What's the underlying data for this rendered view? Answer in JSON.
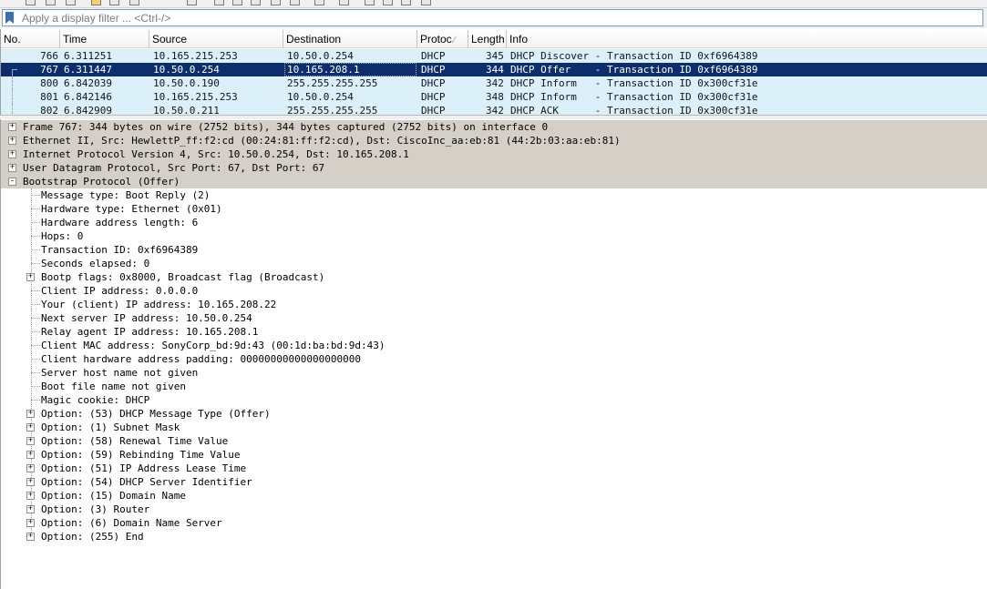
{
  "filter": {
    "placeholder": "Apply a display filter ... <Ctrl-/>"
  },
  "packet_list": {
    "columns": [
      {
        "label": "No."
      },
      {
        "label": "Time"
      },
      {
        "label": "Source"
      },
      {
        "label": "Destination"
      },
      {
        "label": "Protoc",
        "sort_icon": "sort-arrow-icon"
      },
      {
        "label": "Length"
      },
      {
        "label": "Info"
      }
    ],
    "rows": [
      {
        "no": "766",
        "time": "6.311251",
        "source": "10.165.215.253",
        "destination": "10.50.0.254",
        "protocol": "DHCP",
        "length": "345",
        "info": "DHCP Discover - Transaction ID 0xf6964389",
        "selected": false
      },
      {
        "no": "767",
        "time": "6.311447",
        "source": "10.50.0.254",
        "destination": "10.165.208.1",
        "protocol": "DHCP",
        "length": "344",
        "info": "DHCP Offer    - Transaction ID 0xf6964389",
        "selected": true
      },
      {
        "no": "800",
        "time": "6.842039",
        "source": "10.50.0.190",
        "destination": "255.255.255.255",
        "protocol": "DHCP",
        "length": "342",
        "info": "DHCP Inform   - Transaction ID 0x300cf31e",
        "selected": false
      },
      {
        "no": "801",
        "time": "6.842146",
        "source": "10.165.215.253",
        "destination": "10.50.0.254",
        "protocol": "DHCP",
        "length": "348",
        "info": "DHCP Inform   - Transaction ID 0x300cf31e",
        "selected": false
      },
      {
        "no": "802",
        "time": "6.842909",
        "source": "10.50.0.211",
        "destination": "255.255.255.255",
        "protocol": "DHCP",
        "length": "342",
        "info": "DHCP ACK      - Transaction ID 0x300cf31e",
        "selected": false
      }
    ]
  },
  "details": {
    "top_level": [
      {
        "text": "Frame 767: 344 bytes on wire (2752 bits), 344 bytes captured (2752 bits) on interface 0",
        "expander": "+"
      },
      {
        "text": "Ethernet II, Src: HewlettP_ff:f2:cd (00:24:81:ff:f2:cd), Dst: CiscoInc_aa:eb:81 (44:2b:03:aa:eb:81)",
        "expander": "+"
      },
      {
        "text": "Internet Protocol Version 4, Src: 10.50.0.254, Dst: 10.165.208.1",
        "expander": "+"
      },
      {
        "text": "User Datagram Protocol, Src Port: 67, Dst Port: 67",
        "expander": "+"
      },
      {
        "text": "Bootstrap Protocol (Offer)",
        "expander": "-"
      }
    ],
    "children": [
      {
        "text": "Message type: Boot Reply (2)",
        "expander": ""
      },
      {
        "text": "Hardware type: Ethernet (0x01)",
        "expander": ""
      },
      {
        "text": "Hardware address length: 6",
        "expander": ""
      },
      {
        "text": "Hops: 0",
        "expander": ""
      },
      {
        "text": "Transaction ID: 0xf6964389",
        "expander": ""
      },
      {
        "text": "Seconds elapsed: 0",
        "expander": ""
      },
      {
        "text": "Bootp flags: 0x8000, Broadcast flag (Broadcast)",
        "expander": "+"
      },
      {
        "text": "Client IP address: 0.0.0.0",
        "expander": ""
      },
      {
        "text": "Your (client) IP address: 10.165.208.22",
        "expander": ""
      },
      {
        "text": "Next server IP address: 10.50.0.254",
        "expander": ""
      },
      {
        "text": "Relay agent IP address: 10.165.208.1",
        "expander": ""
      },
      {
        "text": "Client MAC address: SonyCorp_bd:9d:43 (00:1d:ba:bd:9d:43)",
        "expander": ""
      },
      {
        "text": "Client hardware address padding: 00000000000000000000",
        "expander": ""
      },
      {
        "text": "Server host name not given",
        "expander": ""
      },
      {
        "text": "Boot file name not given",
        "expander": ""
      },
      {
        "text": "Magic cookie: DHCP",
        "expander": ""
      },
      {
        "text": "Option: (53) DHCP Message Type (Offer)",
        "expander": "+"
      },
      {
        "text": "Option: (1) Subnet Mask",
        "expander": "+"
      },
      {
        "text": "Option: (58) Renewal Time Value",
        "expander": "+"
      },
      {
        "text": "Option: (59) Rebinding Time Value",
        "expander": "+"
      },
      {
        "text": "Option: (51) IP Address Lease Time",
        "expander": "+"
      },
      {
        "text": "Option: (54) DHCP Server Identifier",
        "expander": "+"
      },
      {
        "text": "Option: (15) Domain Name",
        "expander": "+"
      },
      {
        "text": "Option: (3) Router",
        "expander": "+"
      },
      {
        "text": "Option: (6) Domain Name Server",
        "expander": "+"
      },
      {
        "text": "Option: (255) End",
        "expander": "+"
      }
    ]
  }
}
